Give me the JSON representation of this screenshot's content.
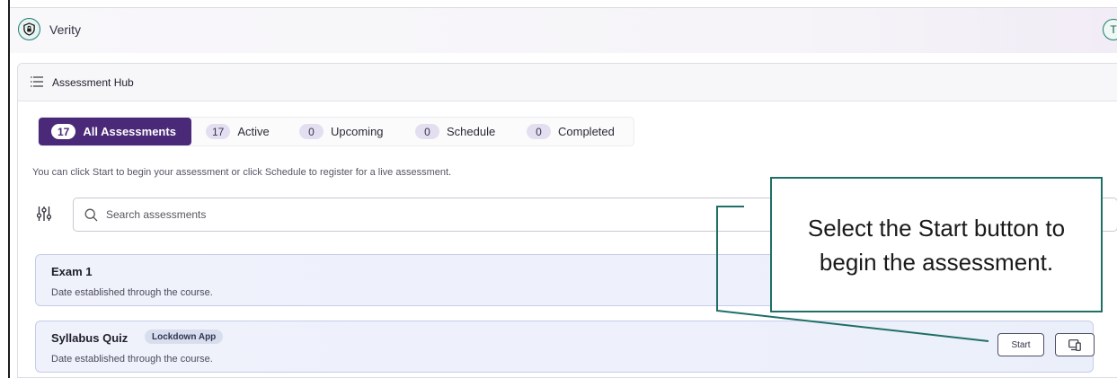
{
  "app": {
    "name": "Verity",
    "user_initial": "T"
  },
  "panel": {
    "title": "Assessment Hub"
  },
  "tabs": [
    {
      "count": "17",
      "label": "All Assessments",
      "active": true
    },
    {
      "count": "17",
      "label": "Active",
      "active": false
    },
    {
      "count": "0",
      "label": "Upcoming",
      "active": false
    },
    {
      "count": "0",
      "label": "Schedule",
      "active": false
    },
    {
      "count": "0",
      "label": "Completed",
      "active": false
    }
  ],
  "hint": "You can click Start to begin your assessment or click Schedule to register for a live assessment.",
  "search": {
    "placeholder": "Search assessments"
  },
  "assessments": [
    {
      "title": "Exam 1",
      "subtitle": "Date established through the course."
    },
    {
      "title": "Syllabus Quiz",
      "badge": "Lockdown App",
      "subtitle": "Date established through the course.",
      "start_label": "Start"
    }
  ],
  "callout": {
    "text": "Select the Start button to begin the assessment."
  },
  "colors": {
    "accent": "#4a2a78",
    "teal": "#1f6f67",
    "card_border": "#c5cde9"
  },
  "icons": [
    "shield-lock-icon",
    "hamburger-icon",
    "filter-sliders-icon",
    "search-icon",
    "devices-icon"
  ]
}
